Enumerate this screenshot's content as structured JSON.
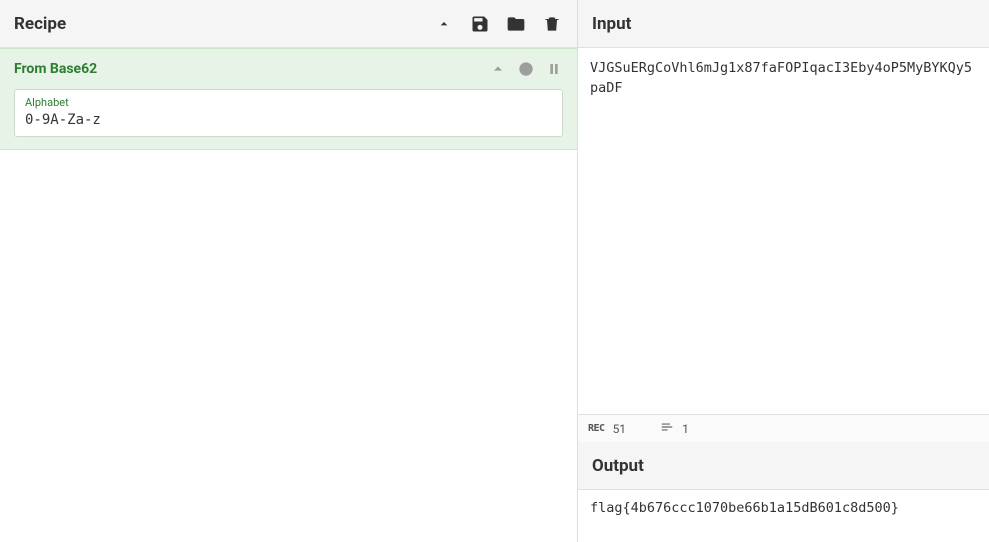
{
  "recipe": {
    "title": "Recipe",
    "operations": [
      {
        "name": "From Base62",
        "fields": {
          "alphabet": {
            "label": "Alphabet",
            "value": "0-9A-Za-z"
          }
        }
      }
    ]
  },
  "input": {
    "title": "Input",
    "text": "VJGSuERgCoVhl6mJg1x87faFOPIqacI3Eby4oP5MyBYKQy5paDF"
  },
  "status": {
    "rec_label": "REC",
    "chars": "51",
    "lines": "1"
  },
  "output": {
    "title": "Output",
    "text": "flag{4b676ccc1070be66b1a15dB601c8d500}"
  }
}
